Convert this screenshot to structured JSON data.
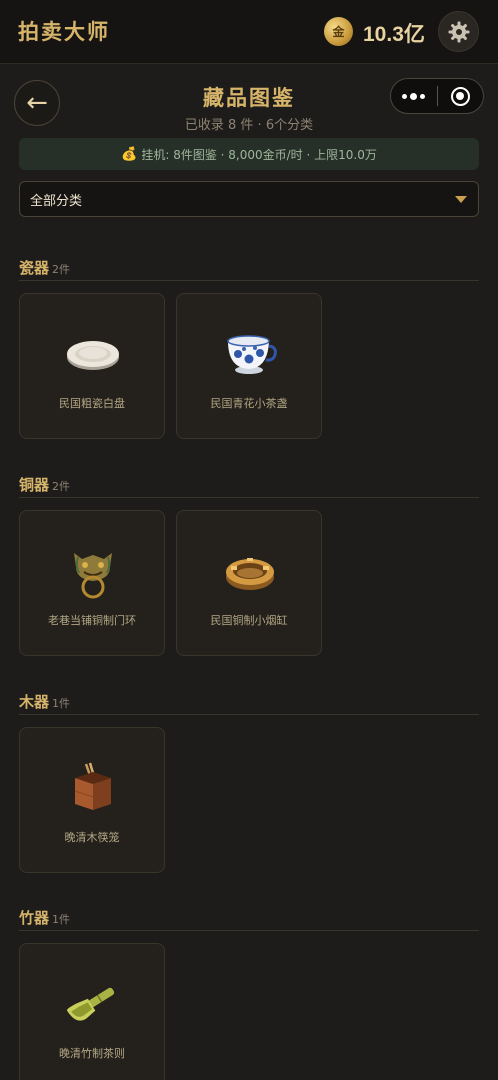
{
  "app": {
    "title": "拍卖大师"
  },
  "wallet": {
    "coin_glyph": "金",
    "amount": "10.3亿"
  },
  "header": {
    "back_glyph": "←",
    "title": "藏品图鉴",
    "subtitle": "已收录 8 件 · 6个分类"
  },
  "idle": {
    "text": "挂机: 8件图鉴 · 8,000金币/时 · 上限10.0万"
  },
  "filter": {
    "selected": "全部分类"
  },
  "sections": [
    {
      "name": "瓷器",
      "count": "2件",
      "items": [
        {
          "name": "民国粗瓷白盘",
          "icon": "white-plate-icon"
        },
        {
          "name": "民国青花小茶盏",
          "icon": "blue-white-teacup-icon"
        }
      ]
    },
    {
      "name": "铜器",
      "count": "2件",
      "items": [
        {
          "name": "老巷当铺铜制门环",
          "icon": "bronze-door-knocker-icon"
        },
        {
          "name": "民国铜制小烟缸",
          "icon": "copper-ashtray-icon"
        }
      ]
    },
    {
      "name": "木器",
      "count": "1件",
      "items": [
        {
          "name": "晚清木筷笼",
          "icon": "wooden-chopstick-holder-icon"
        }
      ]
    },
    {
      "name": "竹器",
      "count": "1件",
      "items": [
        {
          "name": "晚清竹制茶则",
          "icon": "bamboo-tea-scoop-icon"
        }
      ]
    }
  ],
  "colors": {
    "accent": "#d6b46a",
    "background": "#1e1c1a",
    "banner": "#263029"
  }
}
